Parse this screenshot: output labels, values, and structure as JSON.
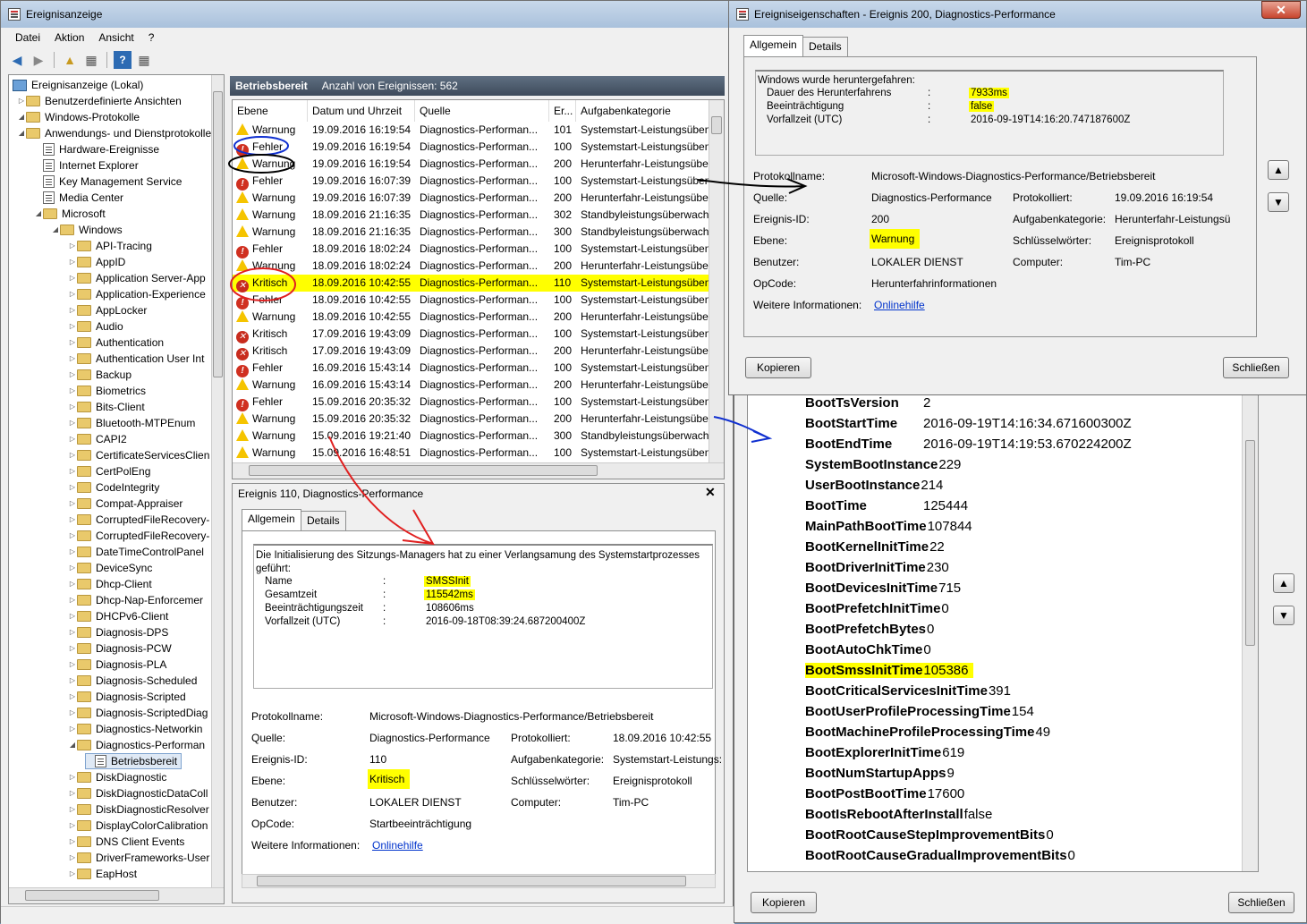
{
  "main_window": {
    "title": "Ereignisanzeige",
    "menu": [
      "Datei",
      "Aktion",
      "Ansicht",
      "?"
    ]
  },
  "tree": {
    "root": "Ereignisanzeige (Lokal)",
    "items": [
      {
        "label": "Benutzerdefinierte Ansichten",
        "level": 1,
        "icon": "folder"
      },
      {
        "label": "Windows-Protokolle",
        "level": 1,
        "icon": "folder"
      },
      {
        "label": "Anwendungs- und Dienstprotokolle",
        "level": 1,
        "icon": "folder"
      },
      {
        "label": "Hardware-Ereignisse",
        "level": 2,
        "icon": "log"
      },
      {
        "label": "Internet Explorer",
        "level": 2,
        "icon": "log"
      },
      {
        "label": "Key Management Service",
        "level": 2,
        "icon": "log"
      },
      {
        "label": "Media Center",
        "level": 2,
        "icon": "log"
      },
      {
        "label": "Microsoft",
        "level": 2,
        "icon": "folder"
      },
      {
        "label": "Windows",
        "level": 3,
        "icon": "folder"
      },
      {
        "label": "API-Tracing",
        "level": 4,
        "icon": "folder"
      },
      {
        "label": "AppID",
        "level": 4,
        "icon": "folder"
      },
      {
        "label": "Application Server-App",
        "level": 4,
        "icon": "folder"
      },
      {
        "label": "Application-Experience",
        "level": 4,
        "icon": "folder"
      },
      {
        "label": "AppLocker",
        "level": 4,
        "icon": "folder"
      },
      {
        "label": "Audio",
        "level": 4,
        "icon": "folder"
      },
      {
        "label": "Authentication",
        "level": 4,
        "icon": "folder"
      },
      {
        "label": "Authentication User Int",
        "level": 4,
        "icon": "folder"
      },
      {
        "label": "Backup",
        "level": 4,
        "icon": "folder"
      },
      {
        "label": "Biometrics",
        "level": 4,
        "icon": "folder"
      },
      {
        "label": "Bits-Client",
        "level": 4,
        "icon": "folder"
      },
      {
        "label": "Bluetooth-MTPEnum",
        "level": 4,
        "icon": "folder"
      },
      {
        "label": "CAPI2",
        "level": 4,
        "icon": "folder"
      },
      {
        "label": "CertificateServicesClien",
        "level": 4,
        "icon": "folder"
      },
      {
        "label": "CertPolEng",
        "level": 4,
        "icon": "folder"
      },
      {
        "label": "CodeIntegrity",
        "level": 4,
        "icon": "folder"
      },
      {
        "label": "Compat-Appraiser",
        "level": 4,
        "icon": "folder"
      },
      {
        "label": "CorruptedFileRecovery-",
        "level": 4,
        "icon": "folder"
      },
      {
        "label": "CorruptedFileRecovery-",
        "level": 4,
        "icon": "folder"
      },
      {
        "label": "DateTimeControlPanel",
        "level": 4,
        "icon": "folder"
      },
      {
        "label": "DeviceSync",
        "level": 4,
        "icon": "folder"
      },
      {
        "label": "Dhcp-Client",
        "level": 4,
        "icon": "folder"
      },
      {
        "label": "Dhcp-Nap-Enforcemer",
        "level": 4,
        "icon": "folder"
      },
      {
        "label": "DHCPv6-Client",
        "level": 4,
        "icon": "folder"
      },
      {
        "label": "Diagnosis-DPS",
        "level": 4,
        "icon": "folder"
      },
      {
        "label": "Diagnosis-PCW",
        "level": 4,
        "icon": "folder"
      },
      {
        "label": "Diagnosis-PLA",
        "level": 4,
        "icon": "folder"
      },
      {
        "label": "Diagnosis-Scheduled",
        "level": 4,
        "icon": "folder"
      },
      {
        "label": "Diagnosis-Scripted",
        "level": 4,
        "icon": "folder"
      },
      {
        "label": "Diagnosis-ScriptedDiag",
        "level": 4,
        "icon": "folder"
      },
      {
        "label": "Diagnostics-Networkin",
        "level": 4,
        "icon": "folder"
      },
      {
        "label": "Diagnostics-Performan",
        "level": 4,
        "icon": "folder"
      },
      {
        "label": "Betriebsbereit",
        "level": 5,
        "icon": "log"
      },
      {
        "label": "DiskDiagnostic",
        "level": 4,
        "icon": "folder"
      },
      {
        "label": "DiskDiagnosticDataColl",
        "level": 4,
        "icon": "folder"
      },
      {
        "label": "DiskDiagnosticResolver",
        "level": 4,
        "icon": "folder"
      },
      {
        "label": "DisplayColorCalibration",
        "level": 4,
        "icon": "folder"
      },
      {
        "label": "DNS Client Events",
        "level": 4,
        "icon": "folder"
      },
      {
        "label": "DriverFrameworks-User",
        "level": 4,
        "icon": "folder"
      },
      {
        "label": "EapHost",
        "level": 4,
        "icon": "folder"
      }
    ]
  },
  "events_header": {
    "title": "Betriebsbereit",
    "count": "Anzahl von Ereignissen: 562"
  },
  "events_columns": [
    "Ebene",
    "Datum und Uhrzeit",
    "Quelle",
    "Er...",
    "Aufgabenkategorie"
  ],
  "events": [
    {
      "level": "Warnung",
      "type": "warn",
      "date": "19.09.2016 16:19:54",
      "source": "Diagnostics-Performan...",
      "id": "101",
      "cat": "Systemstart-Leistungsüben"
    },
    {
      "level": "Fehler",
      "type": "err",
      "date": "19.09.2016 16:19:54",
      "source": "Diagnostics-Performan...",
      "id": "100",
      "cat": "Systemstart-Leistungsüben"
    },
    {
      "level": "Warnung",
      "type": "warn",
      "date": "19.09.2016 16:19:54",
      "source": "Diagnostics-Performan...",
      "id": "200",
      "cat": "Herunterfahr-Leistungsübe"
    },
    {
      "level": "Fehler",
      "type": "err",
      "date": "19.09.2016 16:07:39",
      "source": "Diagnostics-Performan...",
      "id": "100",
      "cat": "Systemstart-Leistungsüben"
    },
    {
      "level": "Warnung",
      "type": "warn",
      "date": "19.09.2016 16:07:39",
      "source": "Diagnostics-Performan...",
      "id": "200",
      "cat": "Herunterfahr-Leistungsübe"
    },
    {
      "level": "Warnung",
      "type": "warn",
      "date": "18.09.2016 21:16:35",
      "source": "Diagnostics-Performan...",
      "id": "302",
      "cat": "Standbyleistungsüberwach"
    },
    {
      "level": "Warnung",
      "type": "warn",
      "date": "18.09.2016 21:16:35",
      "source": "Diagnostics-Performan...",
      "id": "300",
      "cat": "Standbyleistungsüberwach"
    },
    {
      "level": "Fehler",
      "type": "err",
      "date": "18.09.2016 18:02:24",
      "source": "Diagnostics-Performan...",
      "id": "100",
      "cat": "Systemstart-Leistungsüben"
    },
    {
      "level": "Warnung",
      "type": "warn",
      "date": "18.09.2016 18:02:24",
      "source": "Diagnostics-Performan...",
      "id": "200",
      "cat": "Herunterfahr-Leistungsübe"
    },
    {
      "level": "Kritisch",
      "type": "crit",
      "date": "18.09.2016 10:42:55",
      "source": "Diagnostics-Performan...",
      "id": "110",
      "cat": "Systemstart-Leistungsüben",
      "highlight": true
    },
    {
      "level": "Fehler",
      "type": "err",
      "date": "18.09.2016 10:42:55",
      "source": "Diagnostics-Performan...",
      "id": "100",
      "cat": "Systemstart-Leistungsüben"
    },
    {
      "level": "Warnung",
      "type": "warn",
      "date": "18.09.2016 10:42:55",
      "source": "Diagnostics-Performan...",
      "id": "200",
      "cat": "Herunterfahr-Leistungsübe"
    },
    {
      "level": "Kritisch",
      "type": "crit",
      "date": "17.09.2016 19:43:09",
      "source": "Diagnostics-Performan...",
      "id": "100",
      "cat": "Systemstart-Leistungsüben"
    },
    {
      "level": "Kritisch",
      "type": "crit",
      "date": "17.09.2016 19:43:09",
      "source": "Diagnostics-Performan...",
      "id": "200",
      "cat": "Herunterfahr-Leistungsübe"
    },
    {
      "level": "Fehler",
      "type": "err",
      "date": "16.09.2016 15:43:14",
      "source": "Diagnostics-Performan...",
      "id": "100",
      "cat": "Systemstart-Leistungsüben"
    },
    {
      "level": "Warnung",
      "type": "warn",
      "date": "16.09.2016 15:43:14",
      "source": "Diagnostics-Performan...",
      "id": "200",
      "cat": "Herunterfahr-Leistungsübe"
    },
    {
      "level": "Fehler",
      "type": "err",
      "date": "15.09.2016 20:35:32",
      "source": "Diagnostics-Performan...",
      "id": "100",
      "cat": "Systemstart-Leistungsüben"
    },
    {
      "level": "Warnung",
      "type": "warn",
      "date": "15.09.2016 20:35:32",
      "source": "Diagnostics-Performan...",
      "id": "200",
      "cat": "Herunterfahr-Leistungsübe"
    },
    {
      "level": "Warnung",
      "type": "warn",
      "date": "15.09.2016 19:21:40",
      "source": "Diagnostics-Performan...",
      "id": "300",
      "cat": "Standbyleistungsüberwach"
    },
    {
      "level": "Warnung",
      "type": "warn",
      "date": "15.09.2016 16:48:51",
      "source": "Diagnostics-Performan...",
      "id": "100",
      "cat": "Systemstart-Leistungsüben"
    }
  ],
  "detail": {
    "title": "Ereignis 110, Diagnostics-Performance",
    "tabs": [
      "Allgemein",
      "Details"
    ],
    "message_intro": "Die Initialisierung des Sitzungs-Managers hat zu einer Verlangsamung des Systemstartprozesses geführt:",
    "msg_rows": [
      {
        "k": "Name",
        "v": "SMSSInit",
        "hl": true
      },
      {
        "k": "Gesamtzeit",
        "v": "115542ms",
        "hl": true
      },
      {
        "k": "Beeinträchtigungszeit",
        "v": "108606ms",
        "hl": false
      },
      {
        "k": "Vorfallzeit (UTC)",
        "v": "2016-09-18T08:39:24.687200400Z",
        "hl": false
      }
    ],
    "sep": ":",
    "protokollname_lbl": "Protokollname:",
    "protokollname": "Microsoft-Windows-Diagnostics-Performance/Betriebsbereit",
    "quelle_lbl": "Quelle:",
    "quelle": "Diagnostics-Performance",
    "protokolliert_lbl": "Protokolliert:",
    "protokolliert": "18.09.2016 10:42:55",
    "id_lbl": "Ereignis-ID:",
    "id": "110",
    "aufgabe_lbl": "Aufgabenkategorie:",
    "aufgabe": "Systemstart-Leistungs:",
    "ebene_lbl": "Ebene:",
    "ebene": "Kritisch",
    "schluessel_lbl": "Schlüsselwörter:",
    "schluessel": "Ereignisprotokoll",
    "benutzer_lbl": "Benutzer:",
    "benutzer": "LOKALER DIENST",
    "computer_lbl": "Computer:",
    "computer": "Tim-PC",
    "opcode_lbl": "OpCode:",
    "opcode": "Startbeeinträchtigung",
    "info_lbl": "Weitere Informationen:",
    "info": "Onlinehilfe"
  },
  "props": {
    "title": "Ereigniseigenschaften - Ereignis 200, Diagnostics-Performance",
    "tabs": [
      "Allgemein",
      "Details"
    ],
    "message_intro": "Windows wurde heruntergefahren:",
    "msg_rows": [
      {
        "k": "Dauer des Herunterfahrens",
        "v": "7933ms",
        "hl": true
      },
      {
        "k": "Beeinträchtigung",
        "v": "false",
        "hl": true
      },
      {
        "k": "Vorfallzeit (UTC)",
        "v": "2016-09-19T14:16:20.747187600Z",
        "hl": false
      }
    ],
    "sep": ":",
    "protokollname_lbl": "Protokollname:",
    "protokollname": "Microsoft-Windows-Diagnostics-Performance/Betriebsbereit",
    "quelle_lbl": "Quelle:",
    "quelle": "Diagnostics-Performance",
    "protokolliert_lbl": "Protokolliert:",
    "protokolliert": "19.09.2016 16:19:54",
    "id_lbl": "Ereignis-ID:",
    "id": "200",
    "aufgabe_lbl": "Aufgabenkategorie:",
    "aufgabe": "Herunterfahr-Leistungsü",
    "ebene_lbl": "Ebene:",
    "ebene": "Warnung",
    "schluessel_lbl": "Schlüsselwörter:",
    "schluessel": "Ereignisprotokoll",
    "benutzer_lbl": "Benutzer:",
    "benutzer": "LOKALER DIENST",
    "computer_lbl": "Computer:",
    "computer": "Tim-PC",
    "opcode_lbl": "OpCode:",
    "opcode": "Herunterfahrinformationen",
    "info_lbl": "Weitere Informationen:",
    "info": "Onlinehilfe",
    "copy": "Kopieren",
    "close": "Schließen"
  },
  "boot": {
    "rows": [
      {
        "k": "BootTsVersion",
        "v": "2"
      },
      {
        "k": "BootStartTime",
        "v": "2016-09-19T14:16:34.671600300Z"
      },
      {
        "k": "BootEndTime",
        "v": "2016-09-19T14:19:53.670224200Z"
      },
      {
        "k": "SystemBootInstance",
        "v": "229"
      },
      {
        "k": "UserBootInstance",
        "v": "214"
      },
      {
        "k": "BootTime",
        "v": "125444"
      },
      {
        "k": "MainPathBootTime",
        "v": "107844"
      },
      {
        "k": "BootKernelInitTime",
        "v": "22"
      },
      {
        "k": "BootDriverInitTime",
        "v": "230"
      },
      {
        "k": "BootDevicesInitTime",
        "v": "715"
      },
      {
        "k": "BootPrefetchInitTime",
        "v": "0"
      },
      {
        "k": "BootPrefetchBytes",
        "v": "0"
      },
      {
        "k": "BootAutoChkTime",
        "v": "0"
      },
      {
        "k": "BootSmssInitTime",
        "v": "105386",
        "hl": true
      },
      {
        "k": "BootCriticalServicesInitTime",
        "v": "391"
      },
      {
        "k": "BootUserProfileProcessingTime",
        "v": "154"
      },
      {
        "k": "BootMachineProfileProcessingTime",
        "v": "49"
      },
      {
        "k": "BootExplorerInitTime",
        "v": "619"
      },
      {
        "k": "BootNumStartupApps",
        "v": "9"
      },
      {
        "k": "BootPostBootTime",
        "v": "17600"
      },
      {
        "k": "BootIsRebootAfterInstall",
        "v": "false"
      },
      {
        "k": "BootRootCauseStepImprovementBits",
        "v": "0"
      },
      {
        "k": "BootRootCauseGradualImprovementBits",
        "v": "0"
      }
    ],
    "copy": "Kopieren",
    "close": "Schließen"
  },
  "colors": {
    "highlight": "#ffff00",
    "annotation_red": "#e02020",
    "annotation_blue": "#1030d0"
  }
}
